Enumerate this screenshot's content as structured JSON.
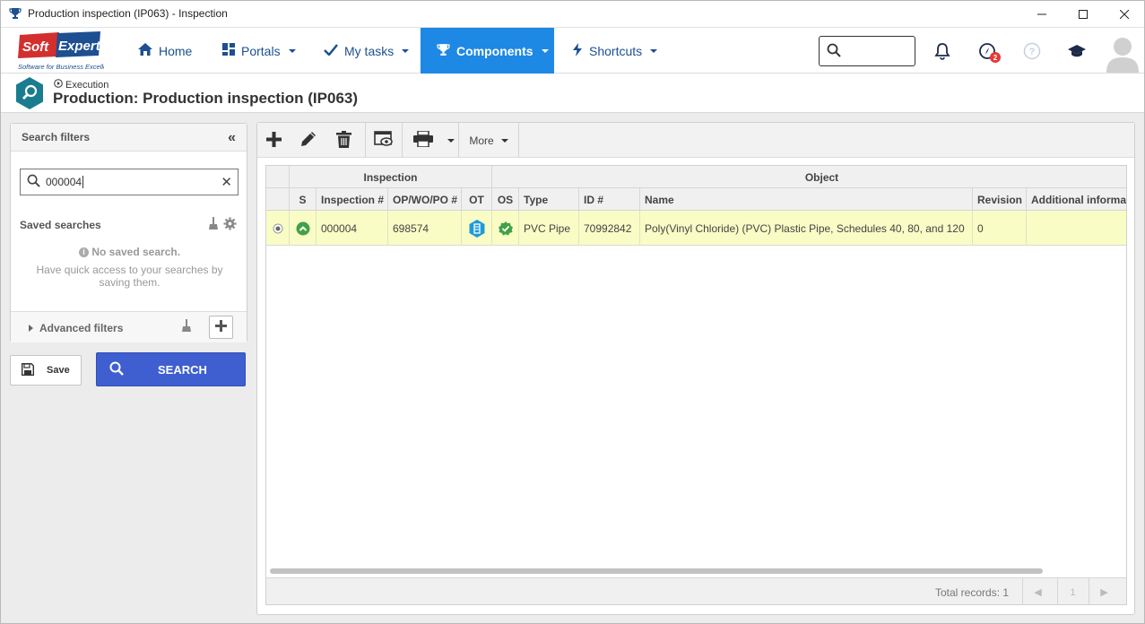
{
  "window": {
    "title": "Production inspection (IP063) - Inspection",
    "icon": "trophy-icon",
    "controls": [
      "minimize-icon",
      "maximize-icon",
      "close-icon"
    ]
  },
  "nav": {
    "logo_text": "SoftExpert",
    "logo_tagline": "Software for Business Excellence",
    "items": [
      {
        "label": "Home",
        "icon": "home-icon"
      },
      {
        "label": "Portals",
        "icon": "grid-icon"
      },
      {
        "label": "My tasks",
        "icon": "check-icon"
      },
      {
        "label": "Components",
        "icon": "trophy-icon"
      },
      {
        "label": "Shortcuts",
        "icon": "lightning-icon"
      }
    ],
    "notification_badge": "2",
    "accent": "#1e88e5"
  },
  "breadcrumb": {
    "parent": "Execution",
    "title": "Production: Production inspection (IP063)"
  },
  "filters": {
    "header": "Search filters",
    "search_value": "000004",
    "saved_searches_title": "Saved searches",
    "no_saved": "No saved search.",
    "no_saved_hint": "Have quick access to your searches by saving them.",
    "advanced_filters": "Advanced filters",
    "save_label": "Save",
    "search_label": "SEARCH"
  },
  "toolbar": {
    "more_label": "More"
  },
  "grid": {
    "group_headers": [
      "Inspection",
      "Object"
    ],
    "columns": [
      "S",
      "Inspection #",
      "OP/WO/PO #",
      "OT",
      "OS",
      "Type",
      "ID #",
      "Name",
      "Revision",
      "Additional informa"
    ],
    "rows": [
      {
        "inspection": "000004",
        "order": "698574",
        "type": "PVC Pipe",
        "id": "70992842",
        "name": "Poly(Vinyl Chloride) (PVC) Plastic Pipe, Schedules 40, 80, and 120",
        "revision": "0",
        "additional": ""
      }
    ],
    "total_records": "Total records: 1",
    "page": "1"
  }
}
